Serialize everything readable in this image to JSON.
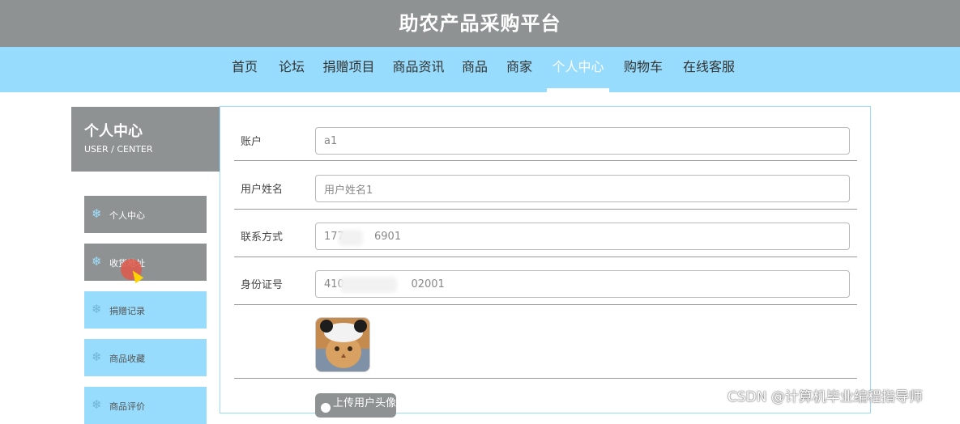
{
  "header": {
    "title": "助农产品采购平台"
  },
  "nav": [
    {
      "label": "首页",
      "active": false
    },
    {
      "label": "论坛",
      "active": false
    },
    {
      "label": "捐赠项目",
      "active": false
    },
    {
      "label": "商品资讯",
      "active": false
    },
    {
      "label": "商品",
      "active": false
    },
    {
      "label": "商家",
      "active": false
    },
    {
      "label": "个人中心",
      "active": true
    },
    {
      "label": "购物车",
      "active": false
    },
    {
      "label": "在线客服",
      "active": false
    }
  ],
  "sidebar": {
    "title": "个人中心",
    "subtitle": "USER / CENTER",
    "items": [
      {
        "label": "个人中心",
        "icon": "snowflake-icon",
        "style": "gray"
      },
      {
        "label": "收货地址",
        "icon": "snowflake-icon",
        "style": "gray"
      },
      {
        "label": "捐赠记录",
        "icon": "snowflake-icon",
        "style": "blue"
      },
      {
        "label": "商品收藏",
        "icon": "snowflake-icon",
        "style": "blue"
      },
      {
        "label": "商品评价",
        "icon": "snowflake-icon",
        "style": "blue"
      }
    ]
  },
  "form": {
    "account": {
      "label": "账户",
      "value": "a1"
    },
    "name": {
      "label": "用户姓名",
      "value": "用户姓名1"
    },
    "contact": {
      "label": "联系方式",
      "value": "177         6901"
    },
    "idcard": {
      "label": "身份证号",
      "value": "410                    02001"
    },
    "upload_label": "上传用户头像"
  },
  "watermark": "CSDN @计算机毕业编程指导师",
  "colors": {
    "header_bg": "#8e9293",
    "nav_bg": "#97dcfc",
    "active_text": "#ffffff"
  }
}
